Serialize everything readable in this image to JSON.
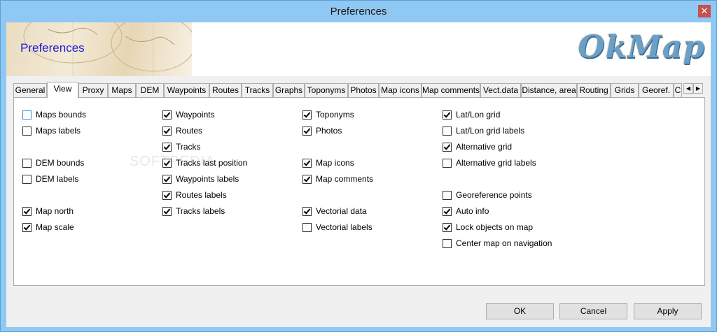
{
  "window": {
    "title": "Preferences",
    "close_glyph": "✕"
  },
  "banner": {
    "title": "Preferences",
    "logo": "OkMap"
  },
  "tabs": [
    {
      "label": "General"
    },
    {
      "label": "View",
      "active": true
    },
    {
      "label": "Proxy"
    },
    {
      "label": "Maps"
    },
    {
      "label": "DEM"
    },
    {
      "label": "Waypoints"
    },
    {
      "label": "Routes"
    },
    {
      "label": "Tracks"
    },
    {
      "label": "Graphs"
    },
    {
      "label": "Toponyms"
    },
    {
      "label": "Photos"
    },
    {
      "label": "Map icons"
    },
    {
      "label": "Map comments"
    },
    {
      "label": "Vect.data"
    },
    {
      "label": "Distance, area"
    },
    {
      "label": "Routing"
    },
    {
      "label": "Grids"
    },
    {
      "label": "Georef."
    },
    {
      "label": "C"
    }
  ],
  "tab_scroll": {
    "left": "◀",
    "right": "▶"
  },
  "watermark": "SOFTPEDIA",
  "options": [
    {
      "id": "maps-bounds",
      "label": "Maps bounds",
      "checked": false,
      "focused": true
    },
    {
      "id": "maps-labels",
      "label": "Maps labels",
      "checked": false
    },
    {
      "id": "dem-bounds",
      "label": "DEM bounds",
      "checked": false
    },
    {
      "id": "dem-labels",
      "label": "DEM labels",
      "checked": false
    },
    {
      "id": "map-north",
      "label": "Map north",
      "checked": true
    },
    {
      "id": "map-scale",
      "label": "Map scale",
      "checked": true
    },
    {
      "id": "waypoints",
      "label": "Waypoints",
      "checked": true
    },
    {
      "id": "routes",
      "label": "Routes",
      "checked": true
    },
    {
      "id": "tracks",
      "label": "Tracks",
      "checked": true
    },
    {
      "id": "tracks-last-position",
      "label": "Tracks last position",
      "checked": true
    },
    {
      "id": "waypoints-labels",
      "label": "Waypoints labels",
      "checked": true
    },
    {
      "id": "routes-labels",
      "label": "Routes labels",
      "checked": true
    },
    {
      "id": "tracks-labels",
      "label": "Tracks labels",
      "checked": true
    },
    {
      "id": "toponyms",
      "label": "Toponyms",
      "checked": true
    },
    {
      "id": "photos",
      "label": "Photos",
      "checked": true
    },
    {
      "id": "map-icons",
      "label": "Map icons",
      "checked": true
    },
    {
      "id": "map-comments",
      "label": "Map comments",
      "checked": true
    },
    {
      "id": "vectorial-data",
      "label": "Vectorial data",
      "checked": true
    },
    {
      "id": "vectorial-labels",
      "label": "Vectorial labels",
      "checked": false
    },
    {
      "id": "latlon-grid",
      "label": "Lat/Lon grid",
      "checked": true
    },
    {
      "id": "latlon-grid-labels",
      "label": "Lat/Lon grid labels",
      "checked": false
    },
    {
      "id": "alternative-grid",
      "label": "Alternative grid",
      "checked": true
    },
    {
      "id": "alternative-grid-labels",
      "label": "Alternative grid labels",
      "checked": false
    },
    {
      "id": "georeference-points",
      "label": "Georeference points",
      "checked": false
    },
    {
      "id": "auto-info",
      "label": "Auto info",
      "checked": true
    },
    {
      "id": "lock-objects",
      "label": "Lock objects on map",
      "checked": true
    },
    {
      "id": "center-map",
      "label": "Center map on navigation",
      "checked": false
    }
  ],
  "buttons": {
    "ok": "OK",
    "cancel": "Cancel",
    "apply": "Apply"
  }
}
